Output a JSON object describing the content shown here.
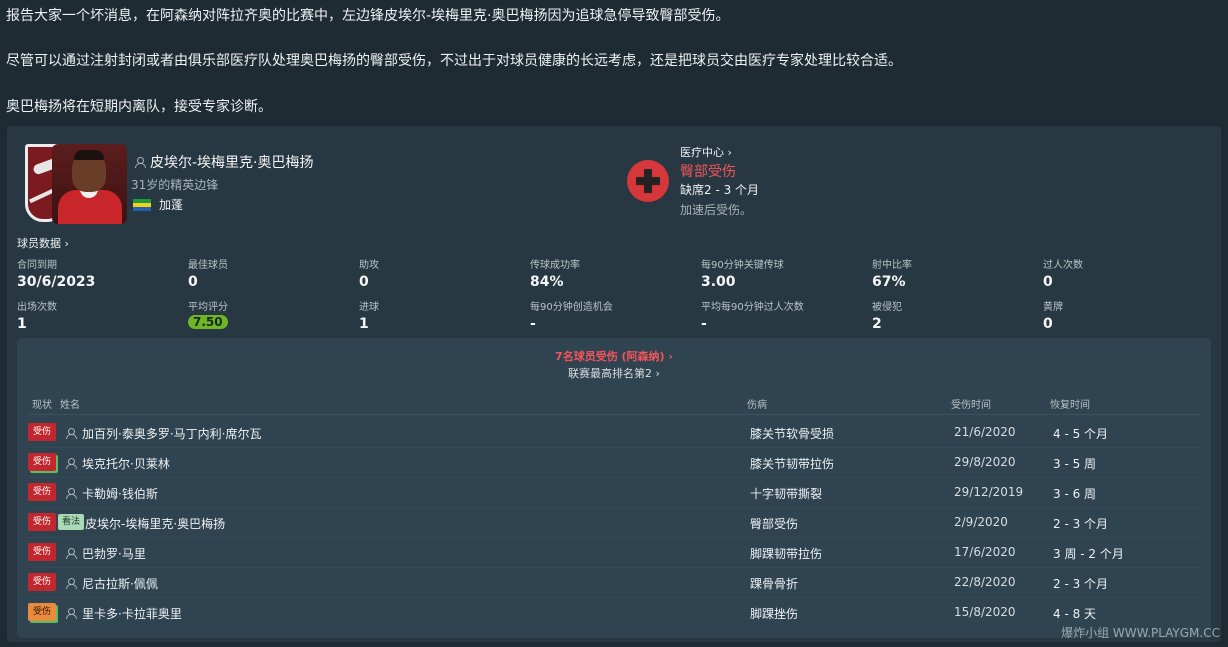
{
  "messages": [
    "报告大家一个坏消息，在阿森纳对阵拉齐奥的比赛中，左边锋皮埃尔-埃梅里克·奥巴梅扬因为追球急停导致臀部受伤。",
    "尽管可以通过注射封闭或者由俱乐部医疗队处理奥巴梅扬的臀部受伤，不过出于对球员健康的长远考虑，还是把球员交由医疗专家处理比较合适。",
    "奥巴梅扬将在短期内离队，接受专家诊断。"
  ],
  "player": {
    "name": "皮埃尔-埃梅里克·奥巴梅扬",
    "desc": "31岁的精英边锋",
    "nation": "加蓬"
  },
  "medical": {
    "title": "医疗中心 ›",
    "injury": "臀部受伤",
    "out": "缺席2 - 3 个月",
    "note": "加速后受伤。"
  },
  "stats": {
    "link": "球员数据 ›",
    "items": [
      {
        "label": "合同到期",
        "value": "30/6/2023"
      },
      {
        "label": "最佳球员",
        "value": "0"
      },
      {
        "label": "助攻",
        "value": "0"
      },
      {
        "label": "传球成功率",
        "value": "84%"
      },
      {
        "label": "每90分钟关键传球",
        "value": "3.00"
      },
      {
        "label": "射中比率",
        "value": "67%"
      },
      {
        "label": "过人次数",
        "value": "0"
      },
      {
        "label": "出场次数",
        "value": "1"
      },
      {
        "label": "平均评分",
        "value": "7.50"
      },
      {
        "label": "进球",
        "value": "1"
      },
      {
        "label": "每90分钟创造机会",
        "value": "-"
      },
      {
        "label": "平均每90分钟过人次数",
        "value": "-"
      },
      {
        "label": "被侵犯",
        "value": "2"
      },
      {
        "label": "黄牌",
        "value": "0"
      }
    ]
  },
  "injury_list": {
    "count": "7名球员受伤 (阿森纳) ›",
    "rank": "联赛最高排名第2 ›",
    "headers": {
      "status": "现状",
      "name": "姓名",
      "injury": "伤病",
      "time": "受伤时间",
      "recovery": "恢复时间"
    },
    "rows": [
      {
        "status": "受伤",
        "name": "加百列·泰奥多罗·马丁内利·席尔瓦",
        "injury": "膝关节软骨受损",
        "date": "21/6/2020",
        "recovery": "4 - 5 个月"
      },
      {
        "status": "受伤",
        "name": "埃克托尔·贝莱林",
        "injury": "膝关节韧带拉伤",
        "date": "29/8/2020",
        "recovery": "3 - 5 周"
      },
      {
        "status": "受伤",
        "name": "卡勒姆·钱伯斯",
        "injury": "十字韧带撕裂",
        "date": "29/12/2019",
        "recovery": "3 - 6 周"
      },
      {
        "status": "受伤",
        "tag": "看法",
        "name": "皮埃尔-埃梅里克·奥巴梅扬",
        "injury": "臀部受伤",
        "date": "2/9/2020",
        "recovery": "2 - 3 个月"
      },
      {
        "status": "受伤",
        "name": "巴勃罗·马里",
        "injury": "脚踝韧带拉伤",
        "date": "17/6/2020",
        "recovery": "3 周 - 2 个月"
      },
      {
        "status": "受伤",
        "name": "尼古拉斯·佩佩",
        "injury": "踝骨骨折",
        "date": "22/8/2020",
        "recovery": "2 - 3 个月"
      },
      {
        "status": "受伤",
        "name": "里卡多·卡拉菲奥里",
        "injury": "脚踝挫伤",
        "date": "15/8/2020",
        "recovery": "4 - 8 天"
      }
    ]
  },
  "watermark": "爆炸小组 WWW.PLAYGM.CC",
  "colors": {
    "background": "#1e2b33",
    "card": "#273842",
    "injury_red": "#f2555a",
    "rating_green": "#6fb528"
  }
}
